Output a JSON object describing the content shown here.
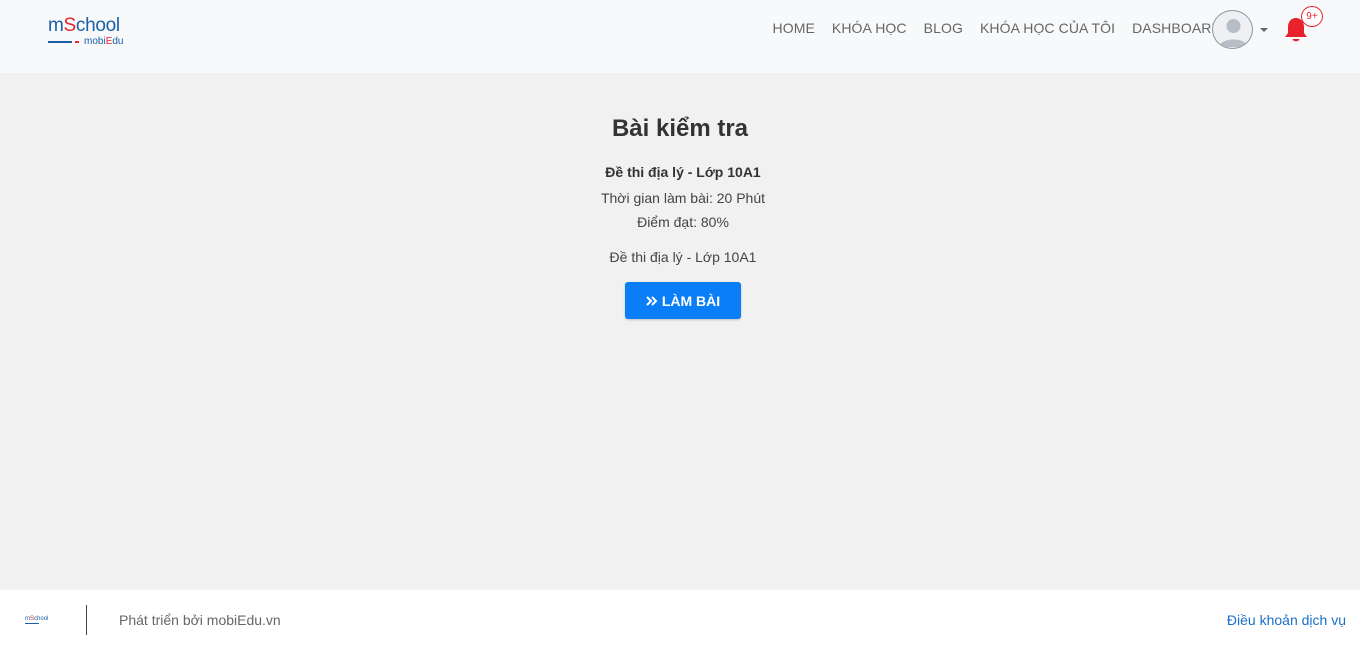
{
  "header": {
    "logo": {
      "brand_prefix": "m",
      "brand_s": "S",
      "brand_rest": "chool",
      "sub_prefix": "mobi",
      "sub_e": "E",
      "sub_rest": "du"
    },
    "nav": [
      {
        "label": "HOME"
      },
      {
        "label": "KHÓA HỌC"
      },
      {
        "label": "BLOG"
      },
      {
        "label": "KHÓA HỌC CỦA TÔI"
      },
      {
        "label": "DASHBOARD"
      }
    ],
    "avatar_icon": "user-avatar-icon",
    "notification": {
      "icon": "bell-icon",
      "badge": "9+",
      "color": "#e8232c"
    }
  },
  "main": {
    "title": "Bài kiểm tra",
    "exam_name": "Đề thi địa lý - Lớp 10A1",
    "duration": "Thời gian làm bài: 20 Phút",
    "pass_score": "Điểm đạt: 80%",
    "description": "Đề thi địa lý - Lớp 10A1",
    "start_button": {
      "icon": "double-chevron-right-icon",
      "label": "LÀM BÀI",
      "color": "#0a7ef7"
    }
  },
  "footer": {
    "developed_by": "Phát triển bởi mobiEdu.vn",
    "terms_link": "Điều khoản dịch vụ"
  }
}
